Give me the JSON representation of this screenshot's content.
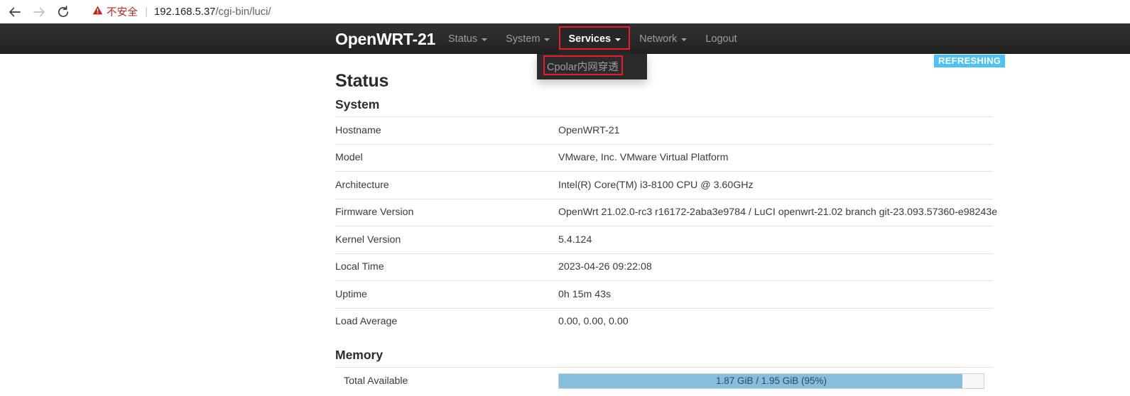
{
  "browser": {
    "back_icon": "back-arrow-icon",
    "forward_icon": "forward-arrow-icon",
    "reload_icon": "reload-icon",
    "security_icon": "warning-triangle-icon",
    "security_label": "不安全",
    "separator": "|",
    "url_host": "192.168.5.37",
    "url_path": "/cgi-bin/luci/"
  },
  "navbar": {
    "brand": "OpenWRT-21",
    "menu": [
      {
        "label": "Status",
        "has_caret": true,
        "active": false,
        "annotated": false
      },
      {
        "label": "System",
        "has_caret": true,
        "active": false,
        "annotated": false
      },
      {
        "label": "Services",
        "has_caret": true,
        "active": true,
        "annotated": true
      },
      {
        "label": "Network",
        "has_caret": true,
        "active": false,
        "annotated": false
      },
      {
        "label": "Logout",
        "has_caret": false,
        "active": false,
        "annotated": false
      }
    ],
    "dropdown": {
      "parent": "Services",
      "items": [
        {
          "label": "Cpolar内网穿透",
          "annotated": true
        }
      ]
    },
    "refresh_badge": "REFRESHING",
    "refresh_badge_color": "#4bc3f7",
    "annotation_color": "#ee1c25"
  },
  "page": {
    "title": "Status",
    "sections": [
      {
        "heading": "System",
        "rows": [
          {
            "label": "Hostname",
            "value": "OpenWRT-21"
          },
          {
            "label": "Model",
            "value": "VMware, Inc. VMware Virtual Platform"
          },
          {
            "label": "Architecture",
            "value": "Intel(R) Core(TM) i3-8100 CPU @ 3.60GHz"
          },
          {
            "label": "Firmware Version",
            "value": "OpenWrt 21.02.0-rc3 r16172-2aba3e9784 / LuCI openwrt-21.02 branch git-23.093.57360-e98243e"
          },
          {
            "label": "Kernel Version",
            "value": "5.4.124"
          },
          {
            "label": "Local Time",
            "value": "2023-04-26 09:22:08"
          },
          {
            "label": "Uptime",
            "value": "0h 15m 43s"
          },
          {
            "label": "Load Average",
            "value": "0.00, 0.00, 0.00"
          }
        ]
      },
      {
        "heading": "Memory",
        "rows": [
          {
            "label": "Total Available",
            "progress": {
              "text": "1.87 GiB / 1.95 GiB (95%)",
              "percent": 95,
              "fill_color": "#87bedd"
            }
          }
        ]
      }
    ]
  }
}
